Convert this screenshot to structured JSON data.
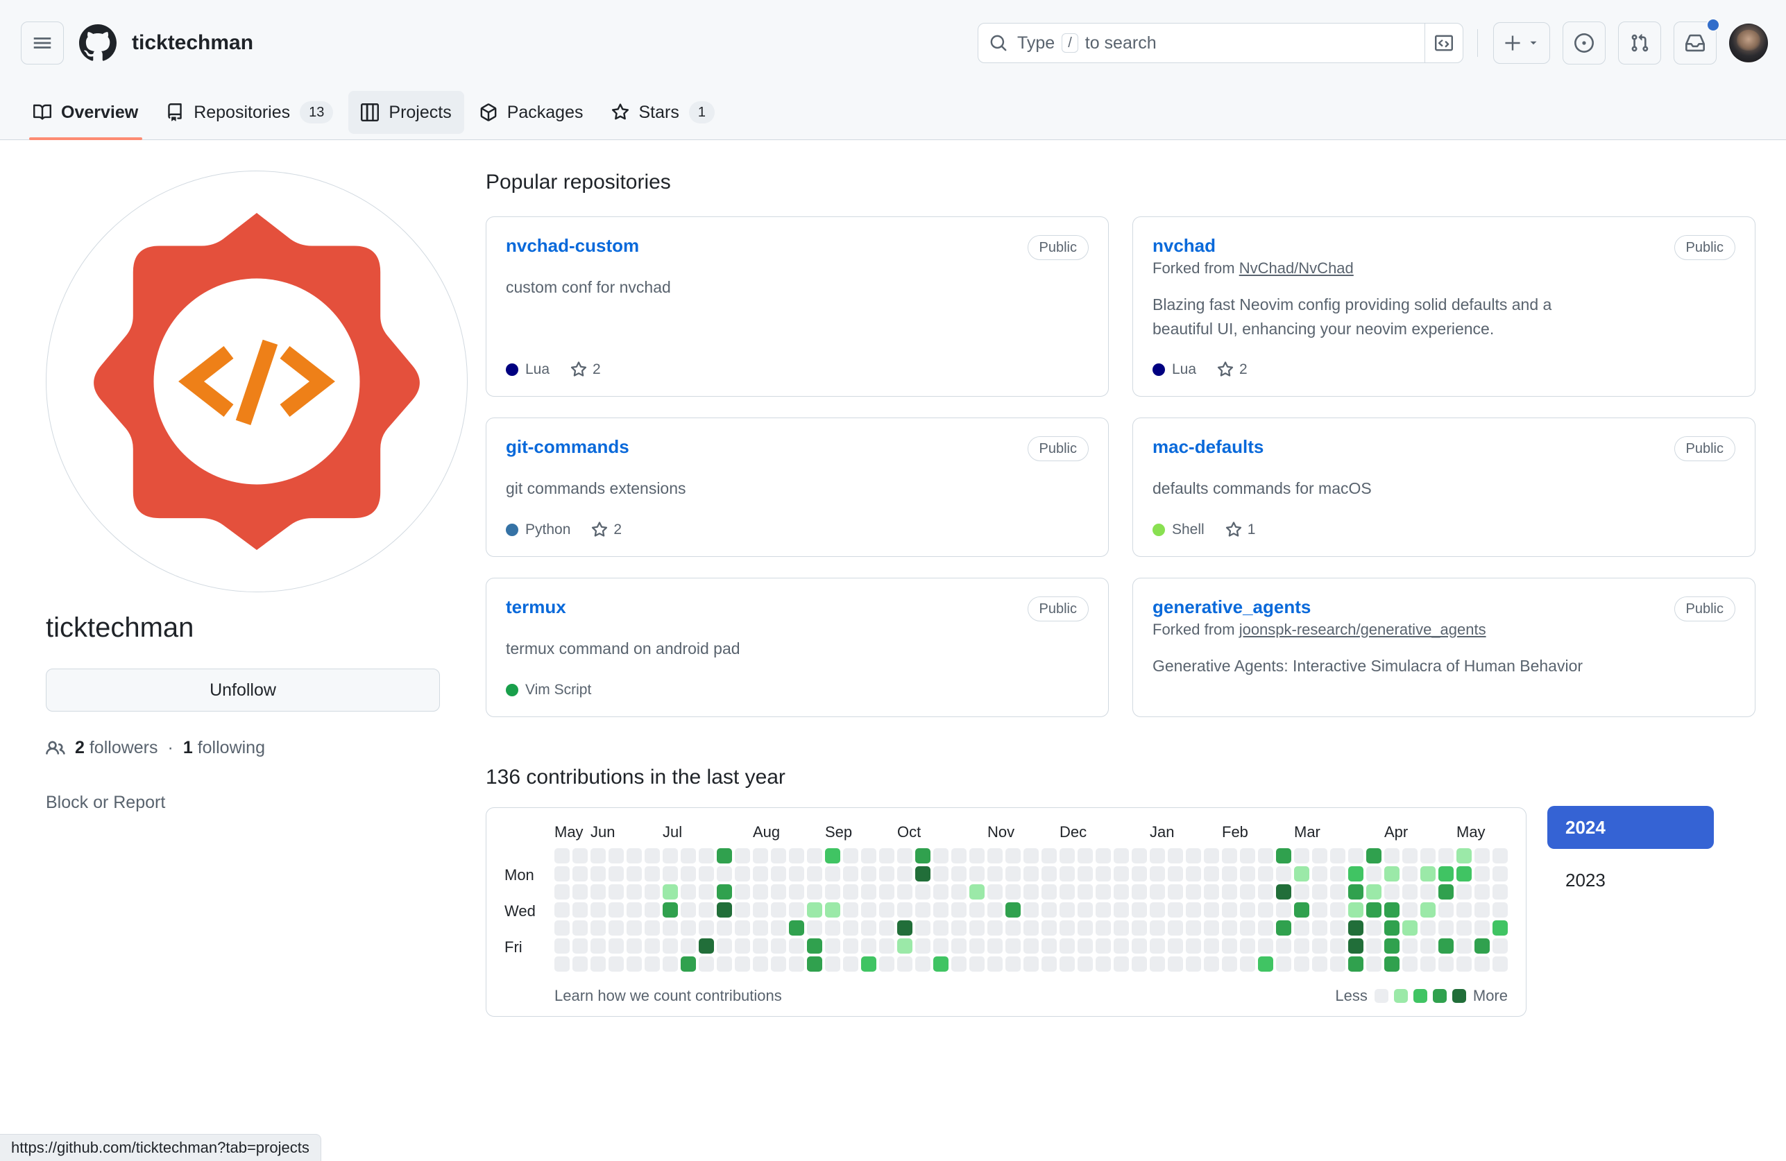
{
  "header": {
    "owner": "ticktechman",
    "menu_icon": "hamburger-icon",
    "logo_icon": "github-logo-icon",
    "search": {
      "placeholder": "Type / to search",
      "slash_key": "/"
    },
    "command_palette_label": "Command palette",
    "create_new_label": "Create new",
    "issues_label": "Issues",
    "pull_requests_label": "Pull requests",
    "notifications_label": "Notifications",
    "account_label": "Open user account menu"
  },
  "nav": {
    "tabs": [
      {
        "label": "Overview",
        "icon": "book-icon",
        "count": null,
        "active": true,
        "hovered": false
      },
      {
        "label": "Repositories",
        "icon": "repo-icon",
        "count": "13",
        "active": false,
        "hovered": false
      },
      {
        "label": "Projects",
        "icon": "table-icon",
        "count": null,
        "active": false,
        "hovered": true
      },
      {
        "label": "Packages",
        "icon": "package-icon",
        "count": null,
        "active": false,
        "hovered": false
      },
      {
        "label": "Stars",
        "icon": "star-icon",
        "count": "1",
        "active": false,
        "hovered": false
      }
    ]
  },
  "profile": {
    "avatar_icon": "code-badge-avatar",
    "username": "ticktechman",
    "follow_button": "Unfollow",
    "followers_count": "2",
    "followers_label": "followers",
    "separator": "·",
    "following_count": "1",
    "following_label": "following",
    "block_or_report": "Block or Report",
    "people_icon": "people-icon"
  },
  "repositories": {
    "section_title": "Popular repositories",
    "items": [
      {
        "name": "nvchad-custom",
        "visibility": "Public",
        "forked_prefix": null,
        "forked_from": null,
        "description": "custom conf for nvchad",
        "language": "Lua",
        "language_color": "#000080",
        "stars": "2"
      },
      {
        "name": "nvchad",
        "visibility": "Public",
        "forked_prefix": "Forked from",
        "forked_from": "NvChad/NvChad",
        "description": "Blazing fast Neovim config providing solid defaults and a beautiful UI, enhancing your neovim experience.",
        "language": "Lua",
        "language_color": "#000080",
        "stars": "2"
      },
      {
        "name": "git-commands",
        "visibility": "Public",
        "forked_prefix": null,
        "forked_from": null,
        "description": "git commands extensions",
        "language": "Python",
        "language_color": "#3572A5",
        "stars": "2"
      },
      {
        "name": "mac-defaults",
        "visibility": "Public",
        "forked_prefix": null,
        "forked_from": null,
        "description": "defaults commands for macOS",
        "language": "Shell",
        "language_color": "#89e051",
        "stars": "1"
      },
      {
        "name": "termux",
        "visibility": "Public",
        "forked_prefix": null,
        "forked_from": null,
        "description": "termux command on android pad",
        "language": "Vim Script",
        "language_color": "#199f4b",
        "stars": null
      },
      {
        "name": "generative_agents",
        "visibility": "Public",
        "forked_prefix": "Forked from",
        "forked_from": "joonspk-research/generative_agents",
        "description": "Generative Agents: Interactive Simulacra of Human Behavior",
        "language": null,
        "language_color": null,
        "stars": null
      }
    ]
  },
  "contributions": {
    "title": "136 contributions in the last year",
    "learn_link": "Learn how we count contributions",
    "legend_less": "Less",
    "legend_more": "More",
    "years": [
      {
        "label": "2024",
        "selected": true
      },
      {
        "label": "2023",
        "selected": false
      }
    ],
    "chart_data": {
      "type": "heatmap",
      "title": "136 contributions in the last year",
      "total": 136,
      "months": [
        "May",
        "Jun",
        "Jul",
        "Aug",
        "Sep",
        "Oct",
        "Nov",
        "Dec",
        "Jan",
        "Feb",
        "Mar",
        "Apr",
        "May"
      ],
      "month_week_index": [
        0,
        2,
        6,
        11,
        15,
        19,
        24,
        28,
        33,
        37,
        41,
        46,
        50
      ],
      "weekdays": [
        "Sun",
        "Mon",
        "Tue",
        "Wed",
        "Thu",
        "Fri",
        "Sat"
      ],
      "weekday_labels_shown": [
        "Mon",
        "Wed",
        "Fri"
      ],
      "level_colors": [
        "#ebedf0",
        "#9be9a8",
        "#40c463",
        "#30a14e",
        "#216e39"
      ],
      "weeks": 53,
      "levels": [
        [
          0,
          0,
          0,
          0,
          0,
          0,
          0
        ],
        [
          0,
          0,
          0,
          0,
          0,
          0,
          0
        ],
        [
          0,
          0,
          0,
          0,
          0,
          0,
          0
        ],
        [
          0,
          0,
          0,
          0,
          0,
          0,
          0
        ],
        [
          0,
          0,
          0,
          0,
          0,
          0,
          0
        ],
        [
          0,
          0,
          0,
          0,
          0,
          0,
          0
        ],
        [
          0,
          0,
          1,
          3,
          0,
          0,
          0
        ],
        [
          0,
          0,
          0,
          0,
          0,
          0,
          3
        ],
        [
          0,
          0,
          0,
          0,
          0,
          4,
          0
        ],
        [
          3,
          0,
          3,
          4,
          0,
          0,
          0
        ],
        [
          0,
          0,
          0,
          0,
          0,
          0,
          0
        ],
        [
          0,
          0,
          0,
          0,
          0,
          0,
          0
        ],
        [
          0,
          0,
          0,
          0,
          0,
          0,
          0
        ],
        [
          0,
          0,
          0,
          0,
          3,
          0,
          0
        ],
        [
          0,
          0,
          0,
          1,
          0,
          3,
          3
        ],
        [
          2,
          0,
          0,
          1,
          0,
          0,
          0
        ],
        [
          0,
          0,
          0,
          0,
          0,
          0,
          0
        ],
        [
          0,
          0,
          0,
          0,
          0,
          0,
          2
        ],
        [
          0,
          0,
          0,
          0,
          0,
          0,
          0
        ],
        [
          0,
          0,
          0,
          0,
          4,
          1,
          0
        ],
        [
          3,
          4,
          0,
          0,
          0,
          0,
          0
        ],
        [
          0,
          0,
          0,
          0,
          0,
          0,
          2
        ],
        [
          0,
          0,
          0,
          0,
          0,
          0,
          0
        ],
        [
          0,
          0,
          1,
          0,
          0,
          0,
          0
        ],
        [
          0,
          0,
          0,
          0,
          0,
          0,
          0
        ],
        [
          0,
          0,
          0,
          3,
          0,
          0,
          0
        ],
        [
          0,
          0,
          0,
          0,
          0,
          0,
          0
        ],
        [
          0,
          0,
          0,
          0,
          0,
          0,
          0
        ],
        [
          0,
          0,
          0,
          0,
          0,
          0,
          0
        ],
        [
          0,
          0,
          0,
          0,
          0,
          0,
          0
        ],
        [
          0,
          0,
          0,
          0,
          0,
          0,
          0
        ],
        [
          0,
          0,
          0,
          0,
          0,
          0,
          0
        ],
        [
          0,
          0,
          0,
          0,
          0,
          0,
          0
        ],
        [
          0,
          0,
          0,
          0,
          0,
          0,
          0
        ],
        [
          0,
          0,
          0,
          0,
          0,
          0,
          0
        ],
        [
          0,
          0,
          0,
          0,
          0,
          0,
          0
        ],
        [
          0,
          0,
          0,
          0,
          0,
          0,
          0
        ],
        [
          0,
          0,
          0,
          0,
          0,
          0,
          0
        ],
        [
          0,
          0,
          0,
          0,
          0,
          0,
          0
        ],
        [
          0,
          0,
          0,
          0,
          0,
          0,
          2
        ],
        [
          3,
          0,
          4,
          0,
          3,
          0,
          0
        ],
        [
          0,
          1,
          0,
          3,
          0,
          0,
          0
        ],
        [
          0,
          0,
          0,
          0,
          0,
          0,
          0
        ],
        [
          0,
          0,
          0,
          0,
          0,
          0,
          0
        ],
        [
          0,
          2,
          3,
          1,
          4,
          4,
          3
        ],
        [
          3,
          0,
          1,
          3,
          0,
          0,
          0
        ],
        [
          0,
          1,
          0,
          3,
          3,
          3,
          3
        ],
        [
          0,
          0,
          0,
          0,
          1,
          0,
          0
        ],
        [
          0,
          1,
          0,
          1,
          0,
          0,
          0
        ],
        [
          0,
          2,
          3,
          0,
          0,
          3,
          0
        ],
        [
          1,
          2,
          0,
          0,
          0,
          0,
          0
        ],
        [
          0,
          0,
          0,
          0,
          0,
          3,
          0
        ],
        [
          0,
          0,
          0,
          0,
          2,
          0,
          0
        ]
      ]
    }
  },
  "status_bar": {
    "url": "https://github.com/ticktechman?tab=projects"
  }
}
